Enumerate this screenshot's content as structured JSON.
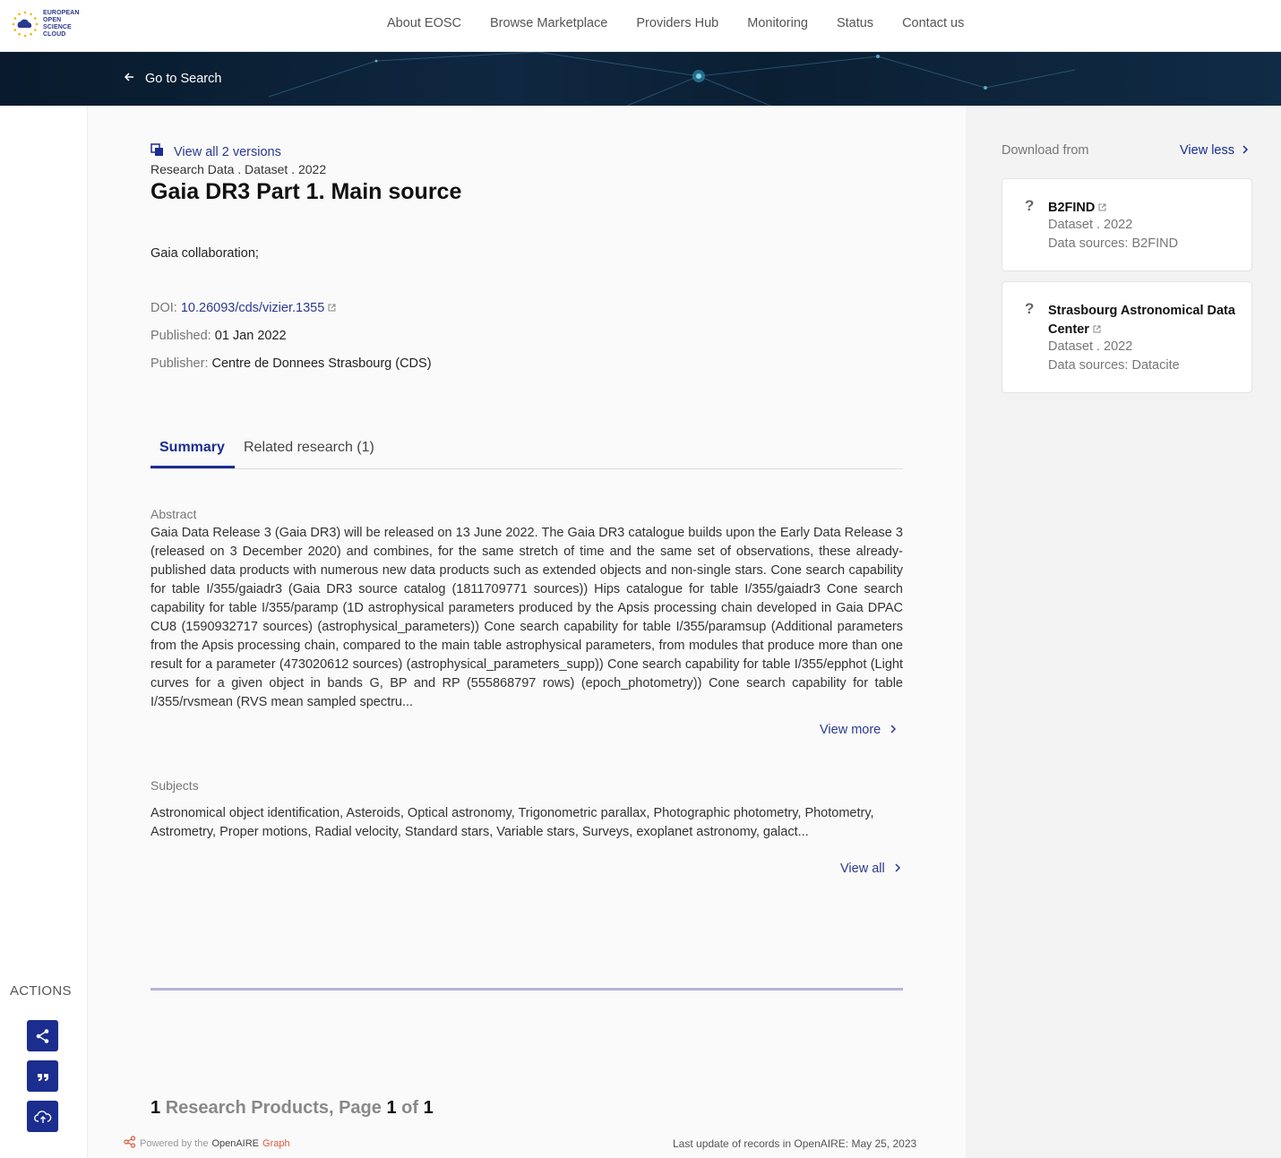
{
  "nav": {
    "logo_line1": "EUROPEAN OPEN",
    "logo_line2": "SCIENCE CLOUD",
    "links": [
      "About EOSC",
      "Browse Marketplace",
      "Providers Hub",
      "Monitoring",
      "Status",
      "Contact us"
    ]
  },
  "banner": {
    "back_label": "Go to Search"
  },
  "actions": {
    "title": "ACTIONS",
    "buttons": [
      "share-icon",
      "quote-icon",
      "cloud-download-icon"
    ]
  },
  "record": {
    "versions_label": "View all 2 versions",
    "type_line": "Research Data . Dataset . 2022",
    "title": "Gaia DR3 Part 1. Main source",
    "authors": "Gaia collaboration;",
    "doi_label": "DOI:",
    "doi_value": "10.26093/cds/vizier.1355",
    "published_label": "Published:",
    "published_value": "01 Jan 2022",
    "publisher_label": "Publisher:",
    "publisher_value": "Centre de Donnees Strasbourg (CDS)"
  },
  "tabs": {
    "summary": "Summary",
    "related": "Related research (1)"
  },
  "abstract": {
    "label": "Abstract",
    "text": "Gaia Data Release 3 (Gaia DR3) will be released on 13 June 2022. The Gaia DR3 catalogue builds upon the Early Data Release 3 (released on 3 December 2020) and combines, for the same stretch of time and the same set of observations, these already-published data products with numerous new data products such as extended objects and non-single stars. Cone search capability for table I/355/gaiadr3 (Gaia DR3 source catalog (1811709771 sources)) Hips catalogue for table I/355/gaiadr3 Cone search capability for table I/355/paramp (1D astrophysical parameters produced by the Apsis processing chain developed in Gaia DPAC CU8 (1590932717 sources) (astrophysical_parameters)) Cone search capability for table I/355/paramsup (Additional parameters from the Apsis processing chain, compared to the main table astrophysical parameters, from modules that produce more than one result for a parameter (473020612 sources) (astrophysical_parameters_supp)) Cone search capability for table I/355/epphot (Light curves for a given object in bands G, BP and RP (555868797 rows) (epoch_photometry)) Cone search capability for table I/355/rvsmean (RVS mean sampled spectru...",
    "view_more": "View more"
  },
  "subjects": {
    "label": "Subjects",
    "text": "Astronomical object identification, Asteroids, Optical astronomy, Trigonometric parallax, Photographic photometry, Photometry, Astrometry, Proper motions, Radial velocity, Standard stars, Variable stars, Surveys, exoplanet astronomy, galact...",
    "view_all": "View all"
  },
  "results": {
    "count": "1",
    "label": "Research Products, Page",
    "page": "1",
    "of": "of",
    "total": "1"
  },
  "footer": {
    "powered_prefix": "Powered by the",
    "powered_brand": "OpenAIRE",
    "powered_graph": "Graph",
    "last_update": "Last update of records in OpenAIRE: May 25, 2023"
  },
  "sidebar": {
    "title": "Download from",
    "view_less": "View less",
    "cards": [
      {
        "name": "B2FIND",
        "type_line": "Dataset . 2022",
        "sources": "Data sources: B2FIND"
      },
      {
        "name": "Strasbourg Astronomical Data Center",
        "type_line": "Dataset . 2022",
        "sources": "Data sources: Datacite"
      }
    ]
  },
  "colors": {
    "accent": "#1b2d8f",
    "link": "#2b3990",
    "banner": "#0b1f33"
  }
}
